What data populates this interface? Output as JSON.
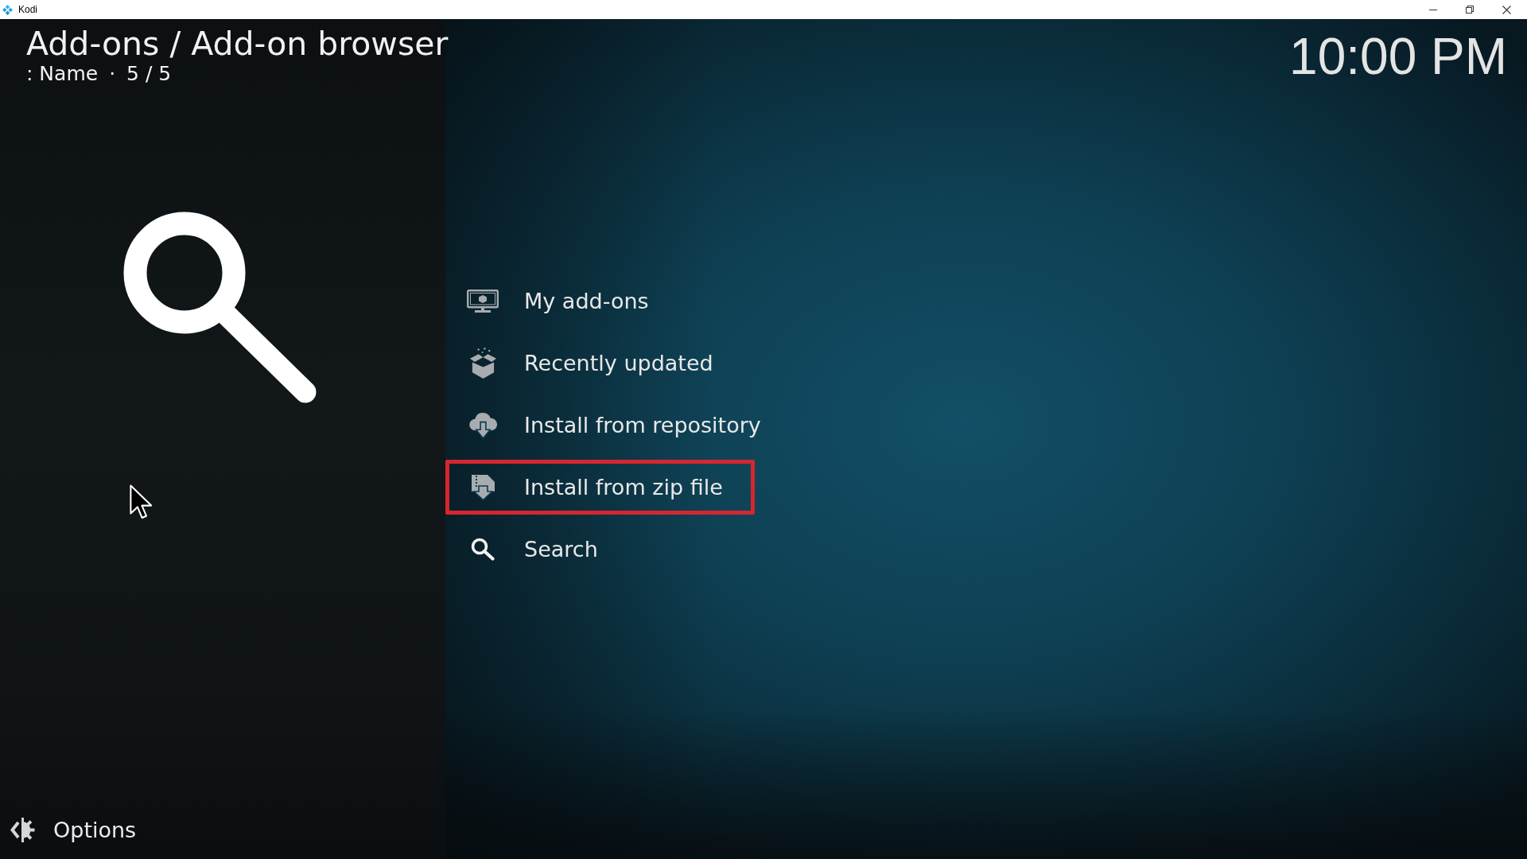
{
  "window": {
    "title": "Kodi"
  },
  "header": {
    "breadcrumb": "Add-ons / Add-on browser",
    "sort_label": ": Name",
    "separator": "·",
    "count": "5 / 5"
  },
  "clock": "10:00 PM",
  "menu": [
    {
      "kind": "my-addons",
      "label": "My add-ons",
      "selected": false
    },
    {
      "kind": "recently-updated",
      "label": "Recently updated",
      "selected": false
    },
    {
      "kind": "install-repository",
      "label": "Install from repository",
      "selected": false
    },
    {
      "kind": "install-zip",
      "label": "Install from zip file",
      "selected": true
    },
    {
      "kind": "search",
      "label": "Search",
      "selected": false
    }
  ],
  "options": {
    "label": "Options"
  }
}
